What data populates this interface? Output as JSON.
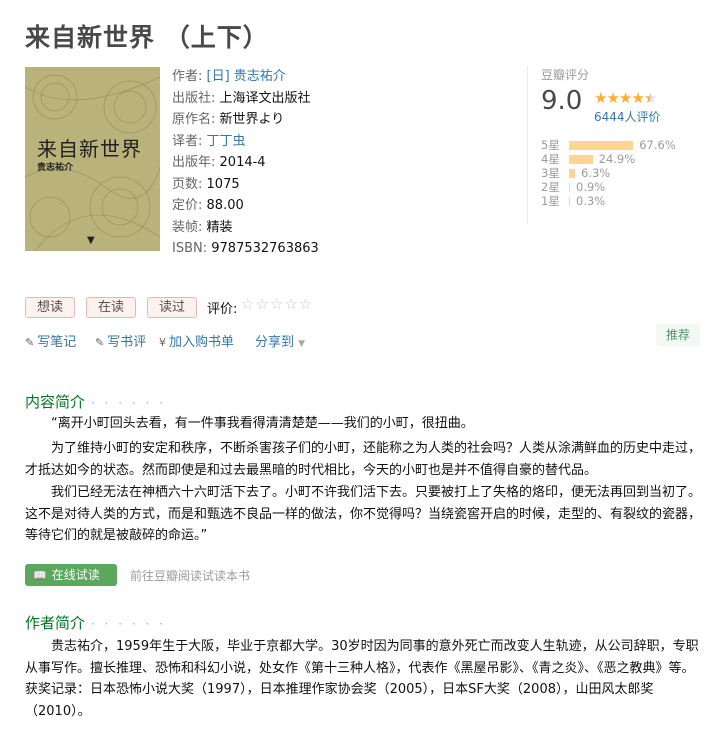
{
  "page": {
    "title": "来自新世界 （上下）"
  },
  "cover": {
    "title": "来自新世界",
    "author": "贵志祐介",
    "bg_color": "#b9b27a"
  },
  "info": {
    "author_label": "作者:",
    "author": "[日] 贵志祐介",
    "publisher_label": "出版社:",
    "publisher": "上海译文出版社",
    "original_label": "原作名:",
    "original": "新世界より",
    "translator_label": "译者:",
    "translator": "丁丁虫",
    "year_label": "出版年:",
    "year": "2014-4",
    "pages_label": "页数:",
    "pages": "1075",
    "price_label": "定价:",
    "price": "88.00",
    "binding_label": "装帧:",
    "binding": "精装",
    "isbn_label": "ISBN:",
    "isbn": "9787532763863"
  },
  "rating": {
    "label": "豆瓣评分",
    "score": "9.0",
    "stars": 4.5,
    "votes": "6444人评价",
    "star_color": "#ffac2d",
    "bar_color": "#ffd596",
    "breakdown": [
      {
        "label": "5星",
        "pct": "67.6%",
        "value": 67.6
      },
      {
        "label": "4星",
        "pct": "24.9%",
        "value": 24.9
      },
      {
        "label": "3星",
        "pct": "6.3%",
        "value": 6.3
      },
      {
        "label": "2星",
        "pct": "0.9%",
        "value": 0.9
      },
      {
        "label": "1星",
        "pct": "0.3%",
        "value": 0.3
      }
    ]
  },
  "actions": {
    "want": "想读",
    "reading": "在读",
    "read": "读过",
    "rate_label": "评价:",
    "rate_stars": "☆☆☆☆☆"
  },
  "tools": {
    "note": "写笔记",
    "review": "写书评",
    "cart": "加入购书单",
    "share": "分享到",
    "recommend": "推荐"
  },
  "intro": {
    "heading": "内容简介",
    "dots": "· · · · · ·",
    "paragraphs": [
      "“离开小町回头去看，有一件事我看得清清楚楚——我们的小町，很扭曲。",
      "为了维持小町的安定和秩序，不断杀害孩子们的小町，还能称之为人类的社会吗？人类从涂满鲜血的历史中走过，才抵达如今的状态。然而即使是和过去最黑暗的时代相比，今天的小町也是并不值得自豪的替代品。",
      "我们已经无法在神栖六十六町活下去了。小町不许我们活下去。只要被打上了失格的烙印，便无法再回到当初了。这不是对待人类的方式，而是和甄选不良品一样的做法，你不觉得吗？当绕瓷窖开启的时候，走型的、有裂纹的瓷器，等待它们的就是被敲碎的命运。”"
    ],
    "read_button": "在线试读",
    "read_note": "前往豆瓣阅读试读本书"
  },
  "author_intro": {
    "heading": "作者简介",
    "dots": "· · · · · ·",
    "text": "贵志祐介，1959年生于大阪，毕业于京都大学。30岁时因为同事的意外死亡而改变人生轨迹，从公司辞职，专职从事写作。擅长推理、恐怖和科幻小说，处女作《第十三种人格》，代表作《黑屋吊影》、《青之炎》、《恶之教典》等。获奖记录：日本恐怖小说大奖（1997），日本推理作家协会奖（2005），日本SF大奖（2008），山田风太郎奖（2010）。"
  }
}
